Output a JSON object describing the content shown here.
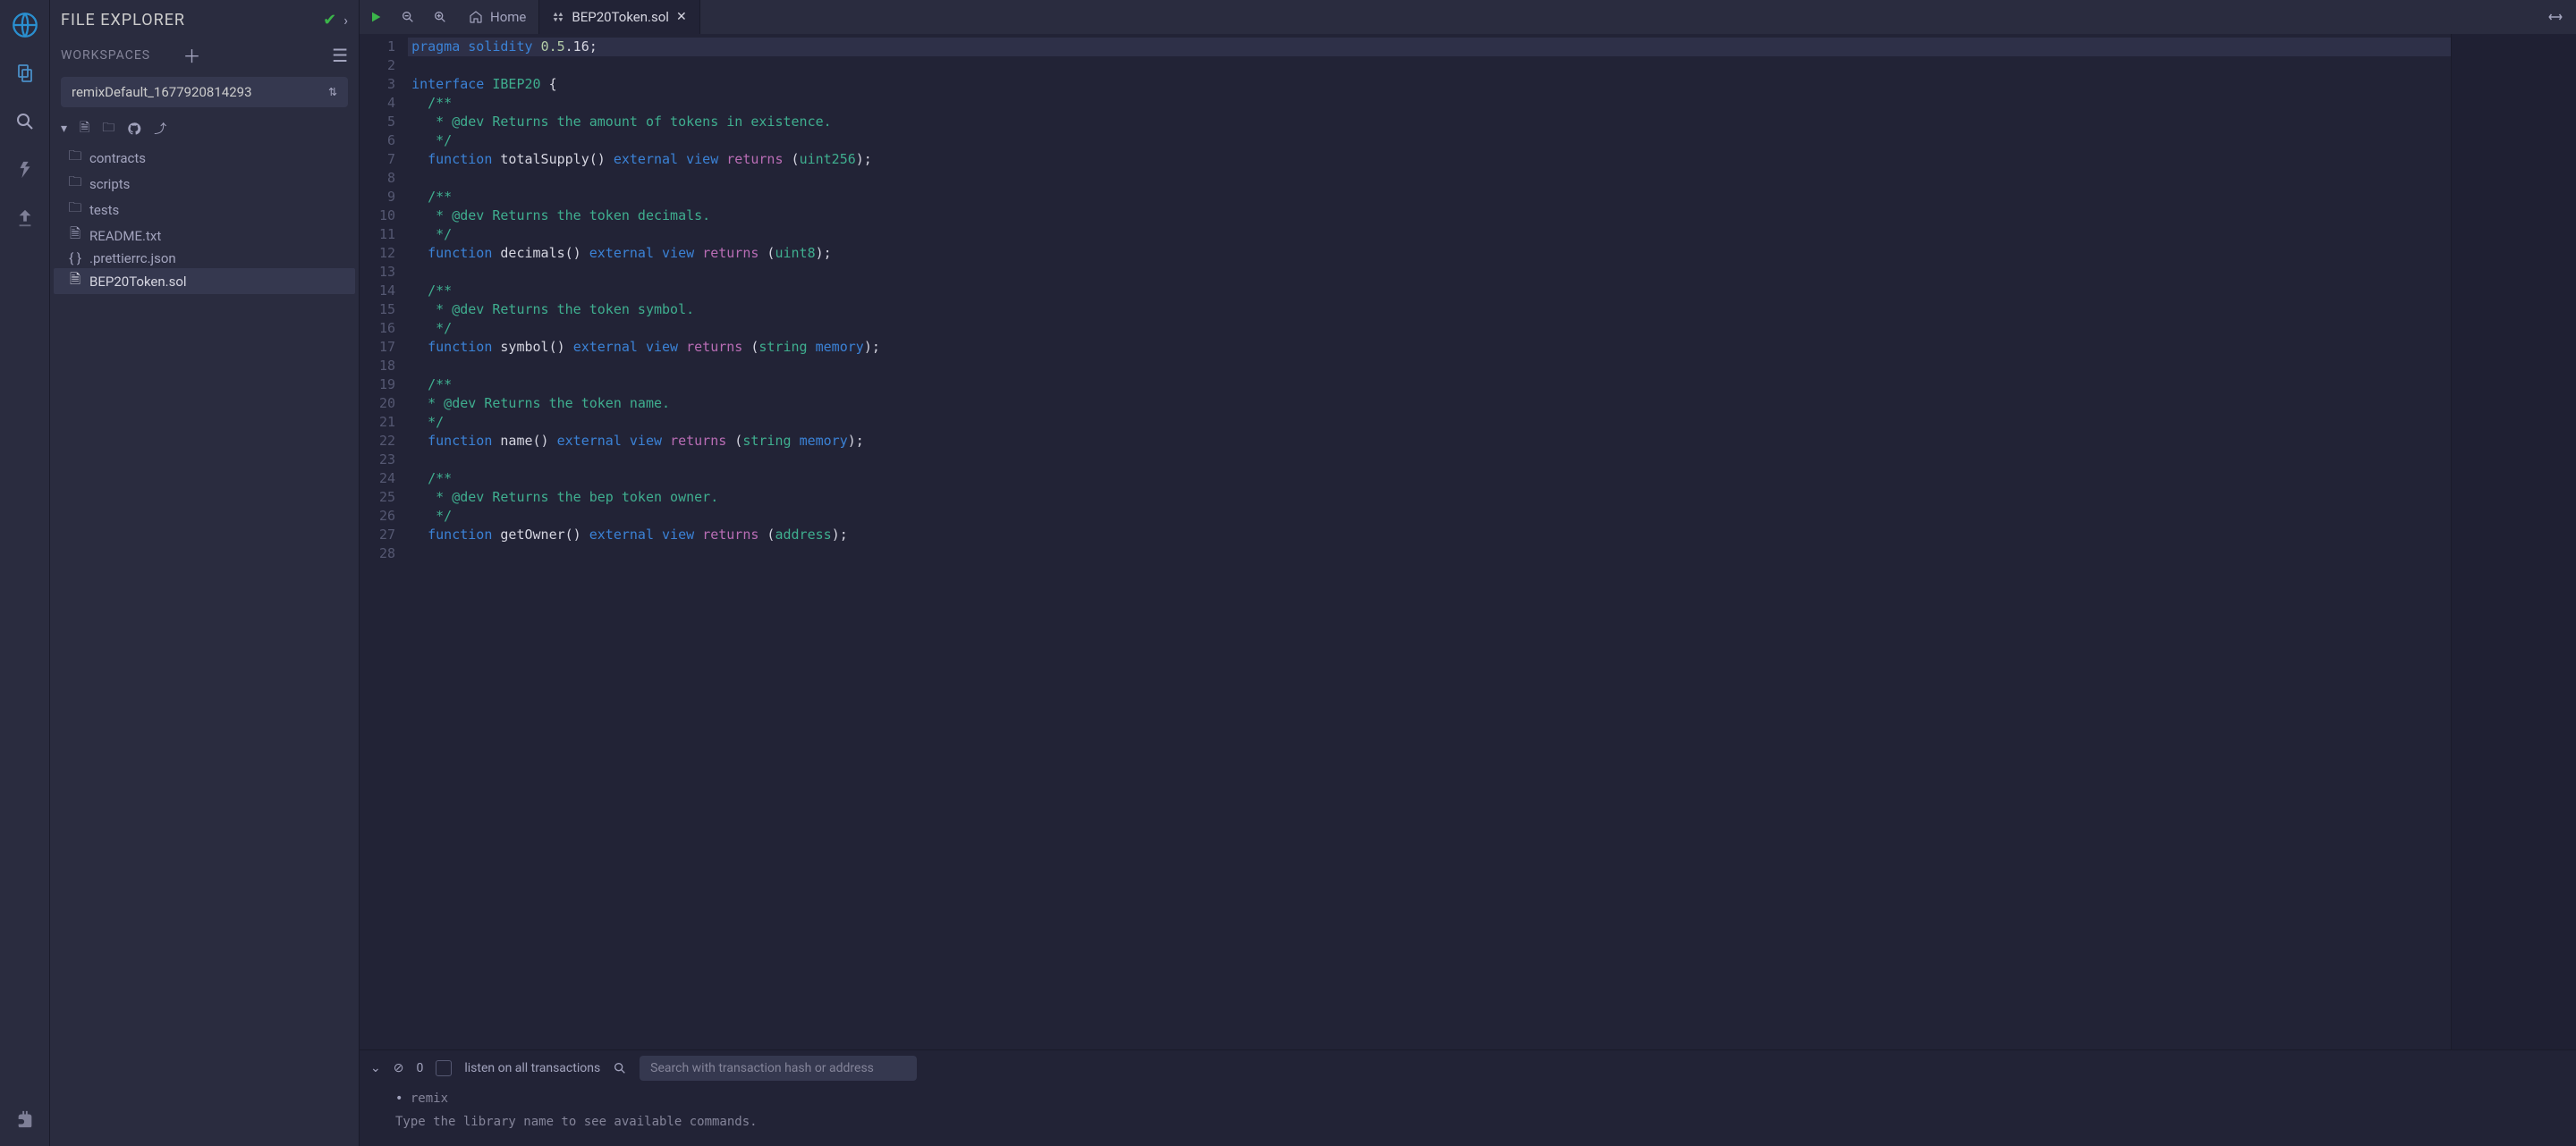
{
  "file_explorer": {
    "title": "FILE EXPLORER",
    "workspaces_label": "WORKSPACES",
    "selected_workspace": "remixDefault_1677920814293",
    "tree": [
      {
        "icon": "folder",
        "label": "contracts"
      },
      {
        "icon": "folder",
        "label": "scripts"
      },
      {
        "icon": "folder",
        "label": "tests"
      },
      {
        "icon": "file",
        "label": "README.txt"
      },
      {
        "icon": "braces",
        "label": ".prettierrc.json"
      },
      {
        "icon": "file",
        "label": "BEP20Token.sol",
        "selected": true
      }
    ]
  },
  "tabs": {
    "home": "Home",
    "file": "BEP20Token.sol"
  },
  "terminal": {
    "listen_label": "listen on all transactions",
    "search_placeholder": "Search with transaction hash or address",
    "pending_count": "0",
    "lines": [
      "remix",
      "Type the library name to see available commands."
    ]
  },
  "code": {
    "lines": [
      [
        {
          "t": "pragma",
          "c": "kw"
        },
        {
          "t": " "
        },
        {
          "t": "solidity",
          "c": "kw"
        },
        {
          "t": " "
        },
        {
          "t": "0.5",
          "c": "num"
        },
        {
          "t": ".16;",
          "c": "ident"
        }
      ],
      [],
      [
        {
          "t": "interface",
          "c": "kw"
        },
        {
          "t": " "
        },
        {
          "t": "IBEP20",
          "c": "type"
        },
        {
          "t": " {",
          "c": "paren"
        }
      ],
      [
        {
          "t": "  /**",
          "c": "comment"
        }
      ],
      [
        {
          "t": "   * @dev Returns the amount of tokens in existence.",
          "c": "comment"
        }
      ],
      [
        {
          "t": "   */",
          "c": "comment"
        }
      ],
      [
        {
          "t": "  "
        },
        {
          "t": "function",
          "c": "kw"
        },
        {
          "t": " "
        },
        {
          "t": "totalSupply",
          "c": "ident"
        },
        {
          "t": "()",
          "c": "paren"
        },
        {
          "t": " "
        },
        {
          "t": "external",
          "c": "kw"
        },
        {
          "t": " "
        },
        {
          "t": "view",
          "c": "kw"
        },
        {
          "t": " "
        },
        {
          "t": "returns",
          "c": "ret"
        },
        {
          "t": " (",
          "c": "paren"
        },
        {
          "t": "uint256",
          "c": "type"
        },
        {
          "t": ");",
          "c": "paren"
        }
      ],
      [],
      [
        {
          "t": "  /**",
          "c": "comment"
        }
      ],
      [
        {
          "t": "   * @dev Returns the token decimals.",
          "c": "comment"
        }
      ],
      [
        {
          "t": "   */",
          "c": "comment"
        }
      ],
      [
        {
          "t": "  "
        },
        {
          "t": "function",
          "c": "kw"
        },
        {
          "t": " "
        },
        {
          "t": "decimals",
          "c": "ident"
        },
        {
          "t": "()",
          "c": "paren"
        },
        {
          "t": " "
        },
        {
          "t": "external",
          "c": "kw"
        },
        {
          "t": " "
        },
        {
          "t": "view",
          "c": "kw"
        },
        {
          "t": " "
        },
        {
          "t": "returns",
          "c": "ret"
        },
        {
          "t": " (",
          "c": "paren"
        },
        {
          "t": "uint8",
          "c": "type"
        },
        {
          "t": ");",
          "c": "paren"
        }
      ],
      [],
      [
        {
          "t": "  /**",
          "c": "comment"
        }
      ],
      [
        {
          "t": "   * @dev Returns the token symbol.",
          "c": "comment"
        }
      ],
      [
        {
          "t": "   */",
          "c": "comment"
        }
      ],
      [
        {
          "t": "  "
        },
        {
          "t": "function",
          "c": "kw"
        },
        {
          "t": " "
        },
        {
          "t": "symbol",
          "c": "ident"
        },
        {
          "t": "()",
          "c": "paren"
        },
        {
          "t": " "
        },
        {
          "t": "external",
          "c": "kw"
        },
        {
          "t": " "
        },
        {
          "t": "view",
          "c": "kw"
        },
        {
          "t": " "
        },
        {
          "t": "returns",
          "c": "ret"
        },
        {
          "t": " (",
          "c": "paren"
        },
        {
          "t": "string",
          "c": "type"
        },
        {
          "t": " "
        },
        {
          "t": "memory",
          "c": "kw"
        },
        {
          "t": ");",
          "c": "paren"
        }
      ],
      [],
      [
        {
          "t": "  /**",
          "c": "comment"
        }
      ],
      [
        {
          "t": "  * @dev Returns the token name.",
          "c": "comment"
        }
      ],
      [
        {
          "t": "  */",
          "c": "comment"
        }
      ],
      [
        {
          "t": "  "
        },
        {
          "t": "function",
          "c": "kw"
        },
        {
          "t": " "
        },
        {
          "t": "name",
          "c": "ident"
        },
        {
          "t": "()",
          "c": "paren"
        },
        {
          "t": " "
        },
        {
          "t": "external",
          "c": "kw"
        },
        {
          "t": " "
        },
        {
          "t": "view",
          "c": "kw"
        },
        {
          "t": " "
        },
        {
          "t": "returns",
          "c": "ret"
        },
        {
          "t": " (",
          "c": "paren"
        },
        {
          "t": "string",
          "c": "type"
        },
        {
          "t": " "
        },
        {
          "t": "memory",
          "c": "kw"
        },
        {
          "t": ");",
          "c": "paren"
        }
      ],
      [],
      [
        {
          "t": "  /**",
          "c": "comment"
        }
      ],
      [
        {
          "t": "   * @dev Returns the bep token owner.",
          "c": "comment"
        }
      ],
      [
        {
          "t": "   */",
          "c": "comment"
        }
      ],
      [
        {
          "t": "  "
        },
        {
          "t": "function",
          "c": "kw"
        },
        {
          "t": " "
        },
        {
          "t": "getOwner",
          "c": "ident"
        },
        {
          "t": "()",
          "c": "paren"
        },
        {
          "t": " "
        },
        {
          "t": "external",
          "c": "kw"
        },
        {
          "t": " "
        },
        {
          "t": "view",
          "c": "kw"
        },
        {
          "t": " "
        },
        {
          "t": "returns",
          "c": "ret"
        },
        {
          "t": " (",
          "c": "paren"
        },
        {
          "t": "address",
          "c": "type"
        },
        {
          "t": ");",
          "c": "paren"
        }
      ],
      []
    ]
  }
}
